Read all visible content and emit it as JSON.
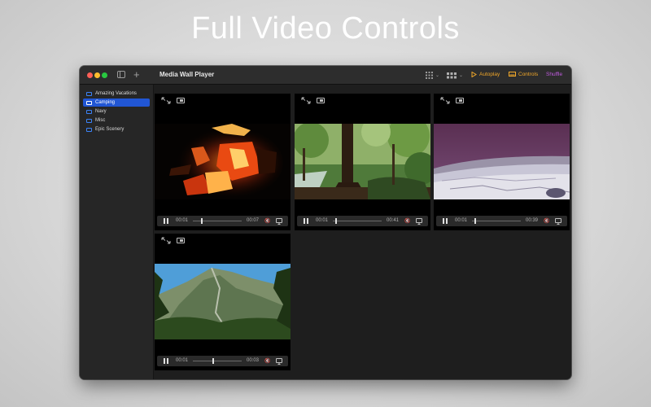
{
  "headline": "Full Video Controls",
  "window": {
    "title": "Media Wall Player"
  },
  "toolbar": {
    "autoplay_label": "Autoplay",
    "controls_label": "Controls",
    "shuffle_label": "Shuffle",
    "colors": {
      "autoplay": "#f0a72a",
      "controls": "#f0a72a",
      "shuffle": "#c05be0"
    }
  },
  "sidebar": {
    "items": [
      {
        "label": "Amazing Vacations",
        "active": false
      },
      {
        "label": "Camping",
        "active": true
      },
      {
        "label": "Navy",
        "active": false
      },
      {
        "label": "Misc",
        "active": false
      },
      {
        "label": "Epic Scenery",
        "active": false
      }
    ]
  },
  "tiles": [
    {
      "scene": "campfire",
      "current": "00:01",
      "duration": "00:07",
      "progress": 0.17
    },
    {
      "scene": "forest",
      "current": "00:01",
      "duration": "00:41",
      "progress": 0.05
    },
    {
      "scene": "river",
      "current": "00:01",
      "duration": "00:39",
      "progress": 0.05
    },
    {
      "scene": "mountain",
      "current": "00:01",
      "duration": "00:03",
      "progress": 0.4
    }
  ]
}
